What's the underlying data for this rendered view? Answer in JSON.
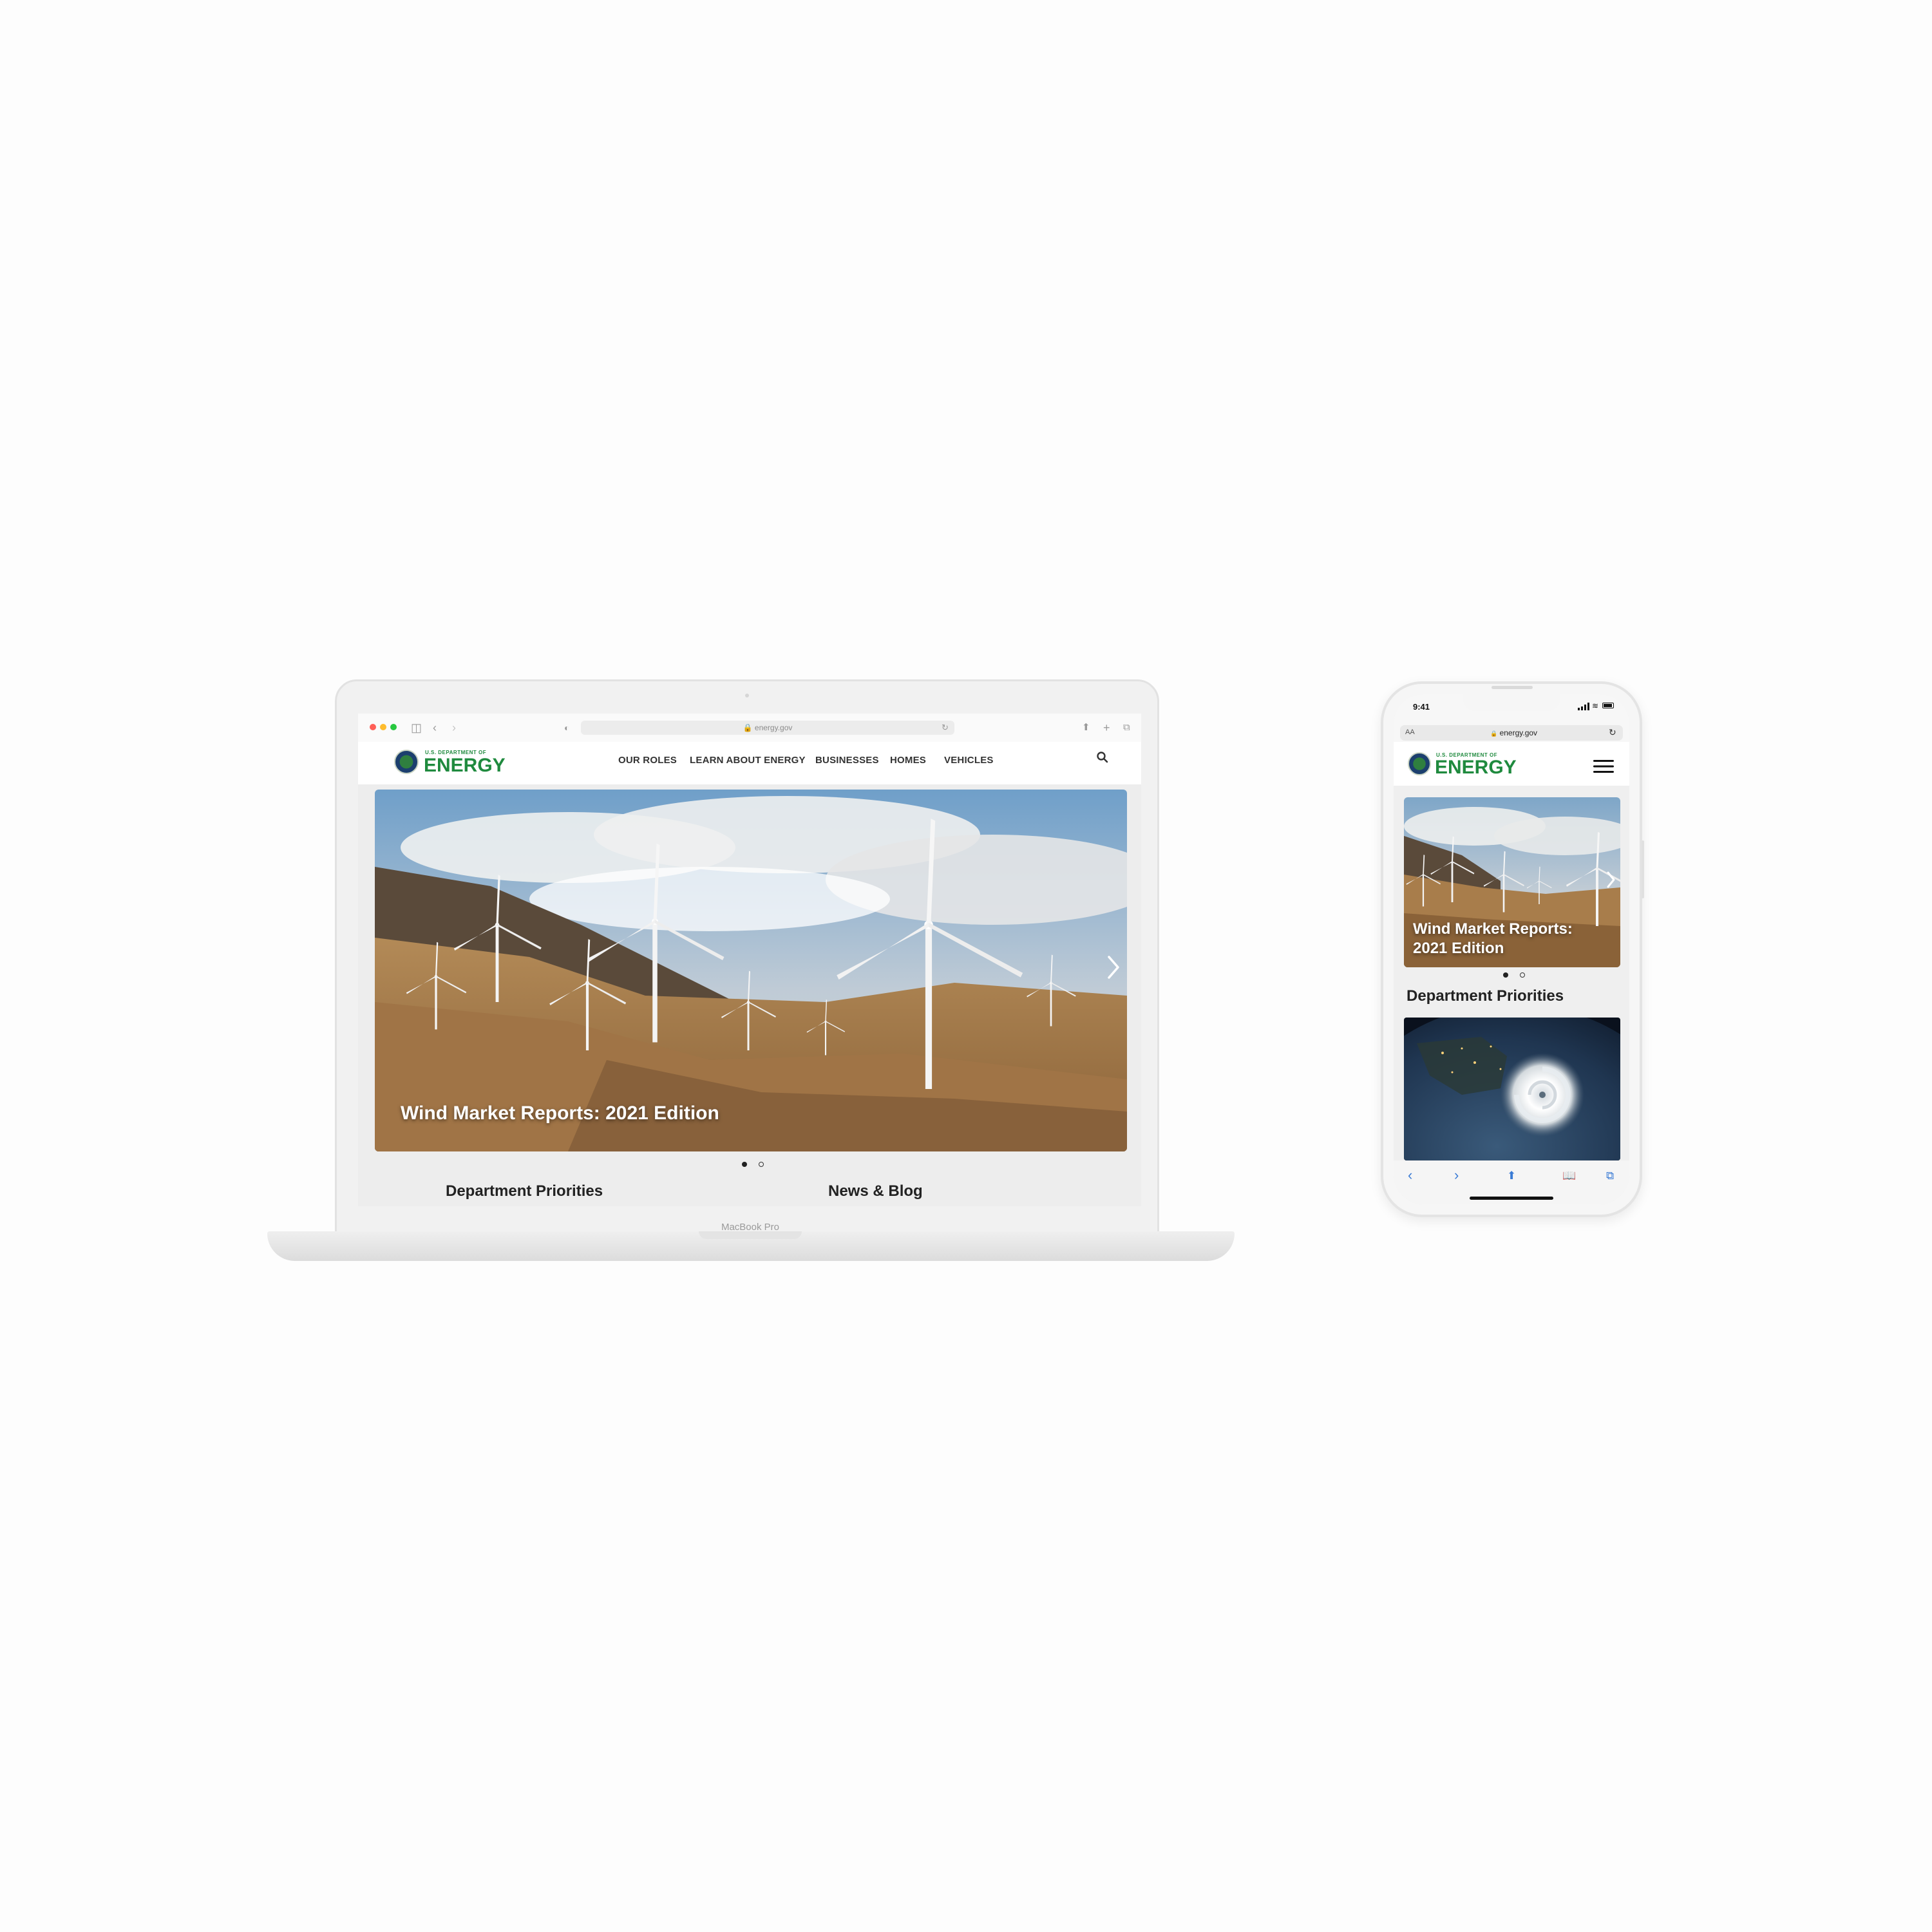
{
  "laptop": {
    "model_label": "MacBook Pro",
    "browser": {
      "url": "energy.gov"
    },
    "site": {
      "logo_small": "U.S. DEPARTMENT OF",
      "logo_big": "ENERGY",
      "nav": [
        "OUR ROLES",
        "LEARN ABOUT ENERGY",
        "BUSINESSES",
        "HOMES",
        "VEHICLES"
      ],
      "hero_caption": "Wind Market Reports: 2021 Edition",
      "sections": [
        "Department Priorities",
        "News & Blog"
      ]
    }
  },
  "phone": {
    "status_time": "9:41",
    "text_size_label": "AA",
    "url": "energy.gov",
    "site": {
      "logo_small": "U.S. DEPARTMENT OF",
      "logo_big": "ENERGY",
      "hero_caption_line1": "Wind Market Reports:",
      "hero_caption_line2": "2021 Edition",
      "section_title": "Department Priorities"
    }
  },
  "colors": {
    "brand_green": "#1f8a3e",
    "safari_blue": "#3a7bd5"
  },
  "icons": [
    "search-icon",
    "next-arrow-icon",
    "menu-icon",
    "reload-icon",
    "lock-icon",
    "share-icon",
    "bookmarks-icon",
    "tabs-icon",
    "back-icon",
    "forward-icon"
  ]
}
